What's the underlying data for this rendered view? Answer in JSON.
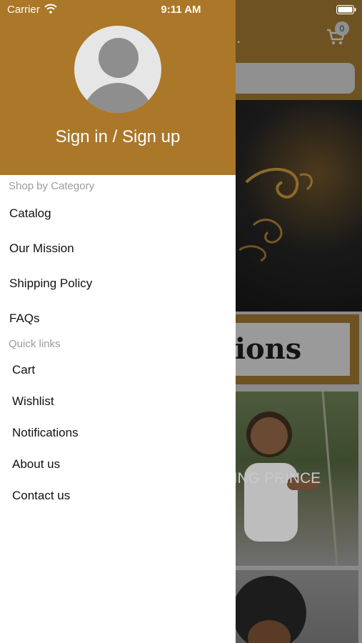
{
  "status_bar": {
    "carrier": "Carrier",
    "time": "9:11 AM"
  },
  "background_app": {
    "title_fragment": "LC.",
    "cart_count": "0",
    "banner_text_fragment": "ctions",
    "product_label_fragment": "RMING PRINCE"
  },
  "drawer": {
    "sign_in_label": "Sign in / Sign up",
    "shop_by_category": {
      "heading": "Shop by Category",
      "items": [
        {
          "label": "Catalog"
        },
        {
          "label": "Our Mission"
        },
        {
          "label": "Shipping Policy"
        },
        {
          "label": "FAQs"
        }
      ]
    },
    "quick_links": {
      "heading": "Quick links",
      "items": [
        {
          "label": "Cart"
        },
        {
          "label": "Wishlist"
        },
        {
          "label": "Notifications"
        },
        {
          "label": "About us"
        },
        {
          "label": "Contact us"
        }
      ]
    }
  },
  "colors": {
    "brand": "#ab7729",
    "drawer_bg": "#ffffff",
    "section_label": "#9b9b9b"
  }
}
